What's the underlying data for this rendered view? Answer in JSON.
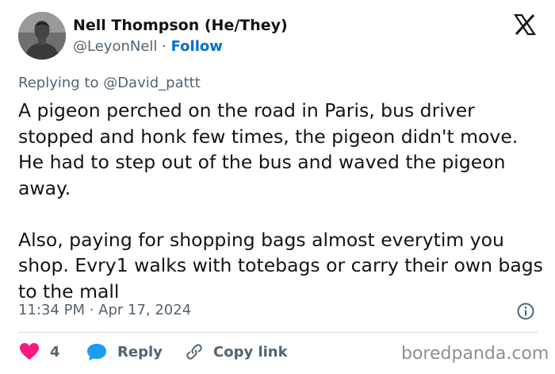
{
  "author": {
    "name": "Nell Thompson (He/They)",
    "handle": "@LeyonNell",
    "separator": "·",
    "follow_label": "Follow"
  },
  "icons": {
    "brand": "x-logo-icon",
    "info": "info-icon",
    "like": "heart-icon",
    "reply": "speech-bubble-icon",
    "copy_link": "link-icon"
  },
  "colors": {
    "like": "#f91880",
    "reply": "#1d9bf0",
    "follow": "#006fd6",
    "secondary_text": "#536471"
  },
  "tweet": {
    "replying_to": "Replying to @David_pattt",
    "paragraphs": [
      "A pigeon perched on the road in Paris,  bus driver stopped and  honk few times, the pigeon didn't move. He had to step out of the bus and waved the pigeon away.",
      "Also, paying for shopping bags almost everytim you shop. Evry1 walks with totebags or carry their own bags to the mall"
    ],
    "timestamp": "11:34 PM · Apr 17, 2024"
  },
  "actions": {
    "like_count": "4",
    "reply_label": "Reply",
    "copy_link_label": "Copy link"
  },
  "watermark": "boredpanda.com"
}
